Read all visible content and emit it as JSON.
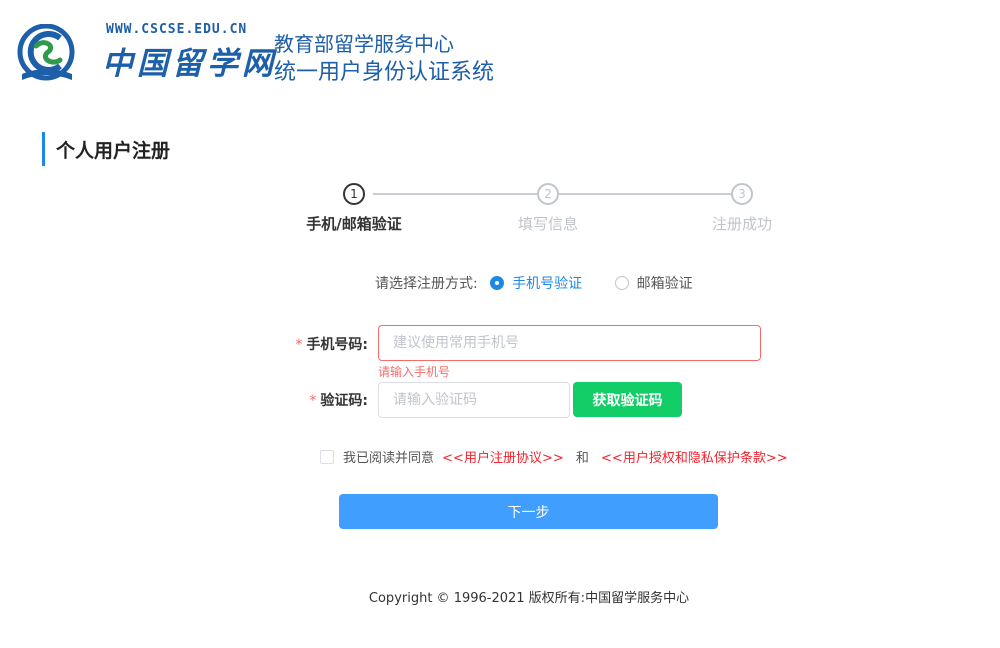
{
  "brand": {
    "url": "WWW.CSCSE.EDU.CN",
    "name_cn": "中国留学网",
    "org": "教育部留学服务中心",
    "system": "统一用户身份认证系统"
  },
  "page": {
    "title": "个人用户注册"
  },
  "steps": [
    {
      "number": "1",
      "label": "手机/邮箱验证",
      "active": true
    },
    {
      "number": "2",
      "label": "填写信息",
      "active": false
    },
    {
      "number": "3",
      "label": "注册成功",
      "active": false
    }
  ],
  "method": {
    "prompt": "请选择注册方式:",
    "options": [
      "手机号验证",
      "邮箱验证"
    ],
    "selected": "手机号验证"
  },
  "form": {
    "phone_label": "手机号码:",
    "phone_placeholder": "建议使用常用手机号",
    "phone_value": "",
    "phone_error": "请输入手机号",
    "code_label": "验证码:",
    "code_placeholder": "请输入验证码",
    "code_value": "",
    "get_code_button": "获取验证码",
    "required_mark": "*"
  },
  "agreement": {
    "text": "我已阅读并同意",
    "link1": "<<用户注册协议>>",
    "conjunction": "和",
    "link2": "<<用户授权和隐私保护条款>>",
    "checked": false
  },
  "next_button": "下一步",
  "footer": {
    "copyright": "Copyright © 1996-2021 版权所有:中国留学服务中心"
  },
  "colors": {
    "brand_blue": "#1d5fa8",
    "accent_blue": "#409eff",
    "success_green": "#13ce66",
    "error_red": "#f56c6c",
    "link_red": "#f5222d"
  }
}
